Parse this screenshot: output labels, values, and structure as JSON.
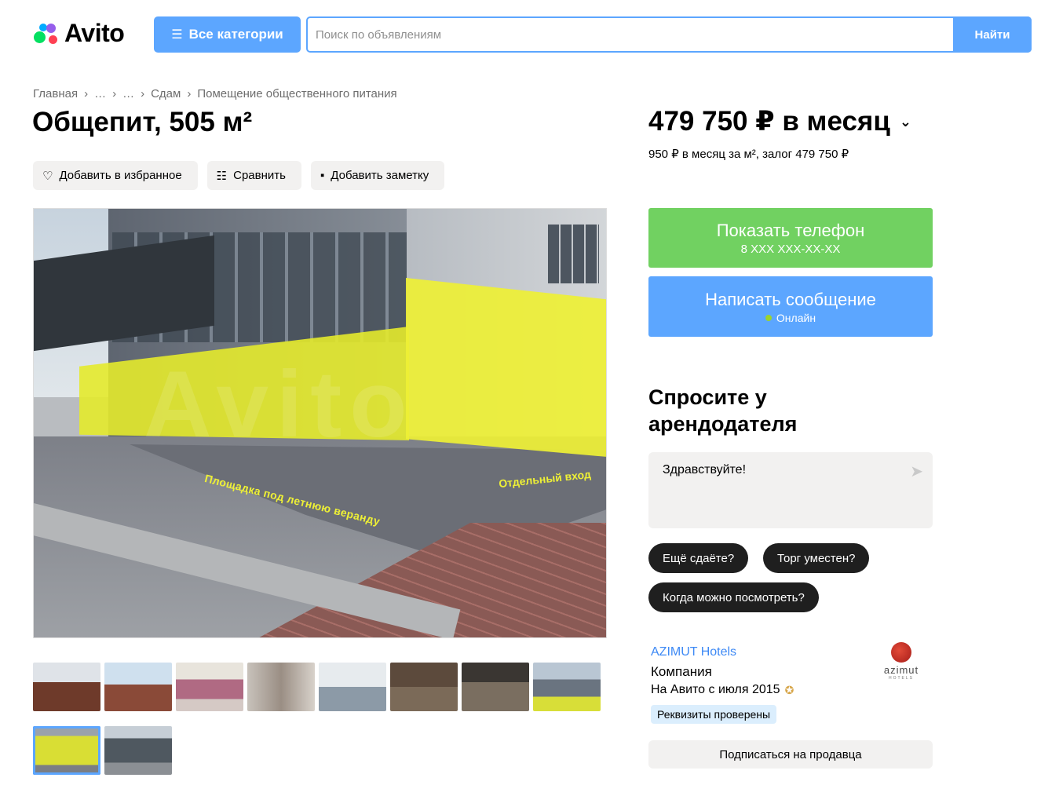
{
  "header": {
    "logo_text": "Avito",
    "categories_label": "Все категории",
    "search_placeholder": "Поиск по объявлениям",
    "search_value": "",
    "search_button": "Найти"
  },
  "breadcrumb": [
    "Главная",
    "…",
    "…",
    "Сдам",
    "Помещение общественного питания"
  ],
  "listing": {
    "title": "Общепит, 505 м²",
    "actions": {
      "favorite": "Добавить в избранное",
      "compare": "Сравнить",
      "note": "Добавить заметку"
    },
    "photo_labels": {
      "veranda": "Площадка под летнюю веранду",
      "entrance": "Отдельный вход"
    },
    "thumbnail_count": 10,
    "active_thumbnail": 9
  },
  "price": {
    "main": "479 750 ₽ в месяц",
    "sub": "950 ₽ в месяц за м², залог 479 750 ₽"
  },
  "contact": {
    "phone_label": "Показать телефон",
    "phone_masked": "8 XXX XXX-XX-XX",
    "message_label": "Написать сообщение",
    "status": "Онлайн"
  },
  "ask": {
    "title": "Спросите у арендодателя",
    "input_value": "Здравствуйте!",
    "chips": [
      "Ещё сдаёте?",
      "Торг уместен?",
      "Когда можно посмотреть?"
    ]
  },
  "seller": {
    "name": "AZIMUT Hotels",
    "type": "Компания",
    "since": "На Авито с июля 2015",
    "verified": "Реквизиты проверены",
    "logo_word": "azimut",
    "logo_sub": "HOTELS",
    "subscribe": "Подписаться на продавца"
  },
  "colors": {
    "accent_blue": "#5ca6ff",
    "green": "#71d161",
    "chip_dark": "#1f1f1f",
    "link": "#3d89f5"
  }
}
